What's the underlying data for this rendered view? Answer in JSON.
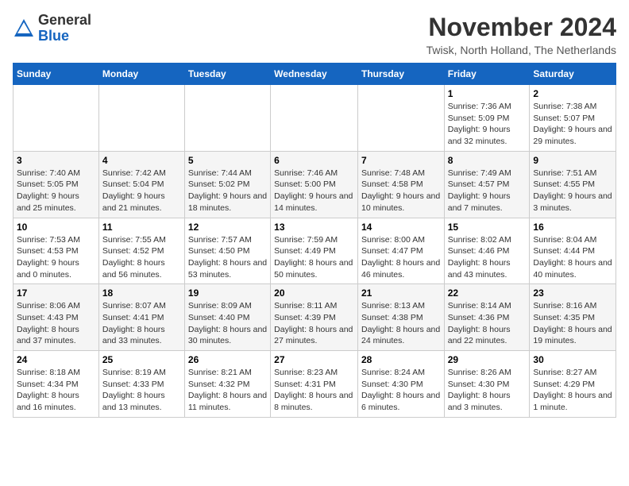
{
  "logo": {
    "general": "General",
    "blue": "Blue"
  },
  "title": "November 2024",
  "location": "Twisk, North Holland, The Netherlands",
  "headers": [
    "Sunday",
    "Monday",
    "Tuesday",
    "Wednesday",
    "Thursday",
    "Friday",
    "Saturday"
  ],
  "rows": [
    [
      {
        "day": "",
        "text": ""
      },
      {
        "day": "",
        "text": ""
      },
      {
        "day": "",
        "text": ""
      },
      {
        "day": "",
        "text": ""
      },
      {
        "day": "",
        "text": ""
      },
      {
        "day": "1",
        "text": "Sunrise: 7:36 AM\nSunset: 5:09 PM\nDaylight: 9 hours and 32 minutes."
      },
      {
        "day": "2",
        "text": "Sunrise: 7:38 AM\nSunset: 5:07 PM\nDaylight: 9 hours and 29 minutes."
      }
    ],
    [
      {
        "day": "3",
        "text": "Sunrise: 7:40 AM\nSunset: 5:05 PM\nDaylight: 9 hours and 25 minutes."
      },
      {
        "day": "4",
        "text": "Sunrise: 7:42 AM\nSunset: 5:04 PM\nDaylight: 9 hours and 21 minutes."
      },
      {
        "day": "5",
        "text": "Sunrise: 7:44 AM\nSunset: 5:02 PM\nDaylight: 9 hours and 18 minutes."
      },
      {
        "day": "6",
        "text": "Sunrise: 7:46 AM\nSunset: 5:00 PM\nDaylight: 9 hours and 14 minutes."
      },
      {
        "day": "7",
        "text": "Sunrise: 7:48 AM\nSunset: 4:58 PM\nDaylight: 9 hours and 10 minutes."
      },
      {
        "day": "8",
        "text": "Sunrise: 7:49 AM\nSunset: 4:57 PM\nDaylight: 9 hours and 7 minutes."
      },
      {
        "day": "9",
        "text": "Sunrise: 7:51 AM\nSunset: 4:55 PM\nDaylight: 9 hours and 3 minutes."
      }
    ],
    [
      {
        "day": "10",
        "text": "Sunrise: 7:53 AM\nSunset: 4:53 PM\nDaylight: 9 hours and 0 minutes."
      },
      {
        "day": "11",
        "text": "Sunrise: 7:55 AM\nSunset: 4:52 PM\nDaylight: 8 hours and 56 minutes."
      },
      {
        "day": "12",
        "text": "Sunrise: 7:57 AM\nSunset: 4:50 PM\nDaylight: 8 hours and 53 minutes."
      },
      {
        "day": "13",
        "text": "Sunrise: 7:59 AM\nSunset: 4:49 PM\nDaylight: 8 hours and 50 minutes."
      },
      {
        "day": "14",
        "text": "Sunrise: 8:00 AM\nSunset: 4:47 PM\nDaylight: 8 hours and 46 minutes."
      },
      {
        "day": "15",
        "text": "Sunrise: 8:02 AM\nSunset: 4:46 PM\nDaylight: 8 hours and 43 minutes."
      },
      {
        "day": "16",
        "text": "Sunrise: 8:04 AM\nSunset: 4:44 PM\nDaylight: 8 hours and 40 minutes."
      }
    ],
    [
      {
        "day": "17",
        "text": "Sunrise: 8:06 AM\nSunset: 4:43 PM\nDaylight: 8 hours and 37 minutes."
      },
      {
        "day": "18",
        "text": "Sunrise: 8:07 AM\nSunset: 4:41 PM\nDaylight: 8 hours and 33 minutes."
      },
      {
        "day": "19",
        "text": "Sunrise: 8:09 AM\nSunset: 4:40 PM\nDaylight: 8 hours and 30 minutes."
      },
      {
        "day": "20",
        "text": "Sunrise: 8:11 AM\nSunset: 4:39 PM\nDaylight: 8 hours and 27 minutes."
      },
      {
        "day": "21",
        "text": "Sunrise: 8:13 AM\nSunset: 4:38 PM\nDaylight: 8 hours and 24 minutes."
      },
      {
        "day": "22",
        "text": "Sunrise: 8:14 AM\nSunset: 4:36 PM\nDaylight: 8 hours and 22 minutes."
      },
      {
        "day": "23",
        "text": "Sunrise: 8:16 AM\nSunset: 4:35 PM\nDaylight: 8 hours and 19 minutes."
      }
    ],
    [
      {
        "day": "24",
        "text": "Sunrise: 8:18 AM\nSunset: 4:34 PM\nDaylight: 8 hours and 16 minutes."
      },
      {
        "day": "25",
        "text": "Sunrise: 8:19 AM\nSunset: 4:33 PM\nDaylight: 8 hours and 13 minutes."
      },
      {
        "day": "26",
        "text": "Sunrise: 8:21 AM\nSunset: 4:32 PM\nDaylight: 8 hours and 11 minutes."
      },
      {
        "day": "27",
        "text": "Sunrise: 8:23 AM\nSunset: 4:31 PM\nDaylight: 8 hours and 8 minutes."
      },
      {
        "day": "28",
        "text": "Sunrise: 8:24 AM\nSunset: 4:30 PM\nDaylight: 8 hours and 6 minutes."
      },
      {
        "day": "29",
        "text": "Sunrise: 8:26 AM\nSunset: 4:30 PM\nDaylight: 8 hours and 3 minutes."
      },
      {
        "day": "30",
        "text": "Sunrise: 8:27 AM\nSunset: 4:29 PM\nDaylight: 8 hours and 1 minute."
      }
    ]
  ]
}
